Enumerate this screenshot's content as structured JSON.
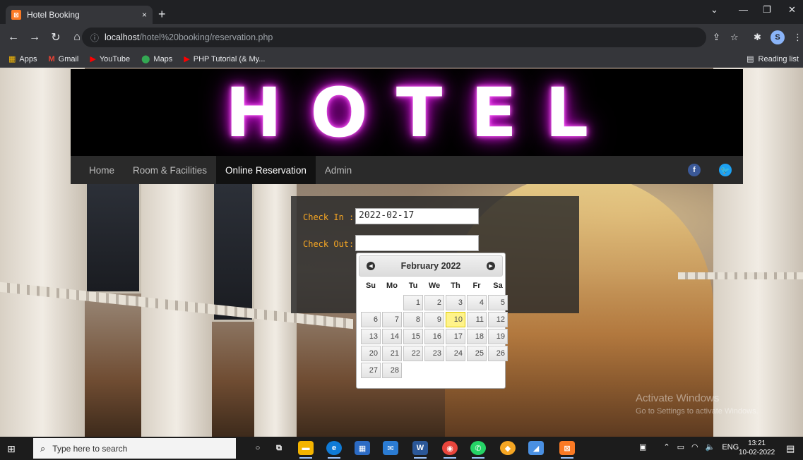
{
  "browser": {
    "tab_title": "Hotel Booking",
    "tab_close": "×",
    "new_tab": "+",
    "url_host": "localhost",
    "url_path": "/hotel%20booking/reservation.php",
    "bookmarks": [
      {
        "icon": "apps-icon",
        "label": "Apps"
      },
      {
        "icon": "gmail-icon",
        "label": "Gmail"
      },
      {
        "icon": "youtube-icon",
        "label": "YouTube"
      },
      {
        "icon": "maps-icon",
        "label": "Maps"
      },
      {
        "icon": "youtube-icon",
        "label": "PHP Tutorial (& My..."
      }
    ],
    "reading_list": "Reading list",
    "profile_initial": "S"
  },
  "site": {
    "logo_text": "HOTEL",
    "nav": [
      {
        "label": "Home",
        "active": false
      },
      {
        "label": "Room & Facilities",
        "active": false
      },
      {
        "label": "Online Reservation",
        "active": true
      },
      {
        "label": "Admin",
        "active": false
      }
    ],
    "social": {
      "facebook": "f",
      "twitter": "t"
    }
  },
  "form": {
    "check_in_label": "Check In :",
    "check_in_value": "2022-02-17",
    "check_out_label": "Check Out:",
    "check_out_value": ""
  },
  "datepicker": {
    "title": "February 2022",
    "weekdays": [
      "Su",
      "Mo",
      "Tu",
      "We",
      "Th",
      "Fr",
      "Sa"
    ],
    "first_weekday_index": 2,
    "days_in_month": 28,
    "today": 10
  },
  "watermark": {
    "line1": "Activate Windows",
    "line2": "Go to Settings to activate Windows."
  },
  "taskbar": {
    "search_placeholder": "Type here to search",
    "tray_lang": "ENG",
    "time": "13:21",
    "date": "10-02-2022"
  },
  "colors": {
    "accent_label": "#f5a623",
    "today_highlight": "#fff38a",
    "neon": "#e033e0"
  }
}
